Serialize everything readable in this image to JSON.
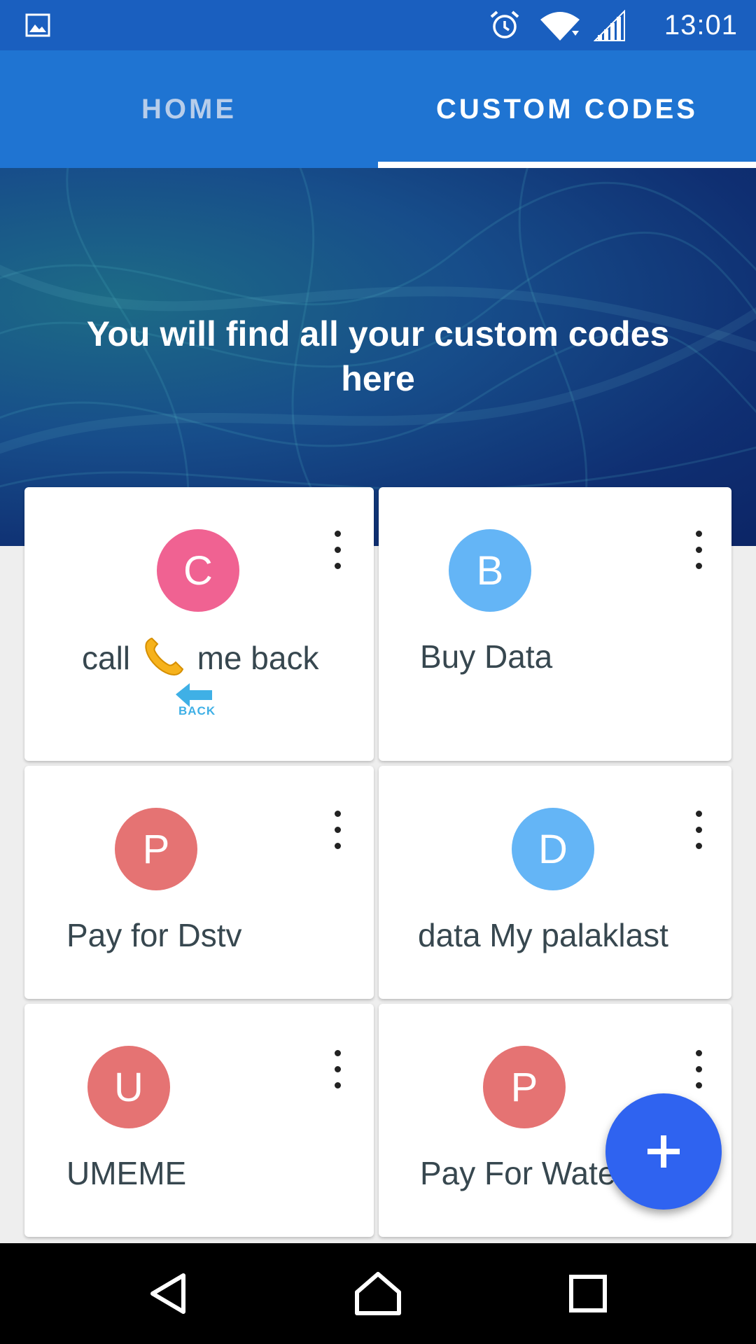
{
  "status_bar": {
    "time": "13:01",
    "icons": [
      "gallery-icon",
      "alarm-icon",
      "wifi-icon",
      "signal-icon"
    ]
  },
  "tabs": [
    {
      "label": "HOME",
      "selected": false
    },
    {
      "label": "CUSTOM CODES",
      "selected": true
    }
  ],
  "hero": {
    "line1": "You will find all your custom codes",
    "line2": "here"
  },
  "cards": [
    {
      "initial": "C",
      "label_part1": "call",
      "label_part2": "me back",
      "sticker_text": "BACK",
      "avatar_color": "#f06292"
    },
    {
      "initial": "B",
      "label": "Buy Data",
      "avatar_color": "#64b5f6"
    },
    {
      "initial": "P",
      "label": "Pay for Dstv",
      "avatar_color": "#e57373"
    },
    {
      "initial": "D",
      "label": "data My palaklast",
      "avatar_color": "#64b5f6"
    },
    {
      "initial": "U",
      "label": "UMEME",
      "avatar_color": "#e57373"
    },
    {
      "initial": "P",
      "label": "Pay For Water",
      "avatar_color": "#e57373"
    }
  ],
  "colors": {
    "status_bar": "#1a5fbf",
    "tab_bar": "#1f74d2",
    "fab": "#2f63f0"
  },
  "fab": {
    "icon": "plus-icon"
  },
  "nav_bar": {
    "icons": [
      "back-icon",
      "home-icon",
      "recents-icon"
    ]
  }
}
